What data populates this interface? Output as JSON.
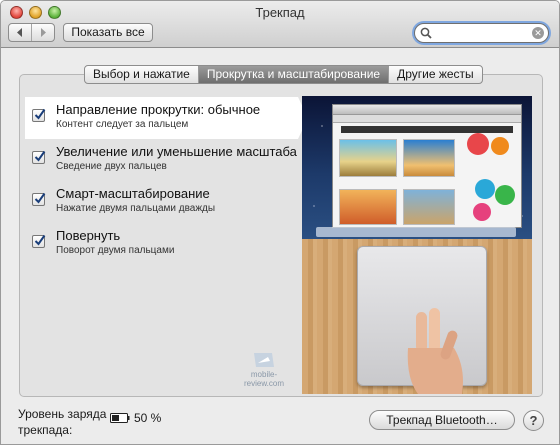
{
  "window": {
    "title": "Трекпад"
  },
  "toolbar": {
    "show_all_label": "Показать все"
  },
  "search": {
    "value": "",
    "placeholder": ""
  },
  "tabs": [
    {
      "label": "Выбор и нажатие",
      "selected": false
    },
    {
      "label": "Прокрутка и масштабирование",
      "selected": true
    },
    {
      "label": "Другие жесты",
      "selected": false
    }
  ],
  "options": [
    {
      "title": "Направление прокрутки: обычное",
      "subtitle": "Контент следует за пальцем",
      "checked": true,
      "selected": true
    },
    {
      "title": "Увеличение или уменьшение масштаба",
      "subtitle": "Сведение двух пальцев",
      "checked": true
    },
    {
      "title": "Смарт-масштабирование",
      "subtitle": "Нажатие двумя пальцами дважды",
      "checked": true
    },
    {
      "title": "Повернуть",
      "subtitle": "Поворот двумя пальцами",
      "checked": true
    }
  ],
  "watermark": "mobile-review.com",
  "footer": {
    "battery_label": "Уровень заряда трекпада:",
    "battery_value": "50 %",
    "battery_level": 0.5,
    "bluetooth_button": "Трекпад Bluetooth…",
    "help_label": "?"
  },
  "icons": [
    "back-icon",
    "forward-icon",
    "search-icon",
    "clear-icon",
    "checkmark-icon",
    "battery-icon",
    "help-icon"
  ]
}
